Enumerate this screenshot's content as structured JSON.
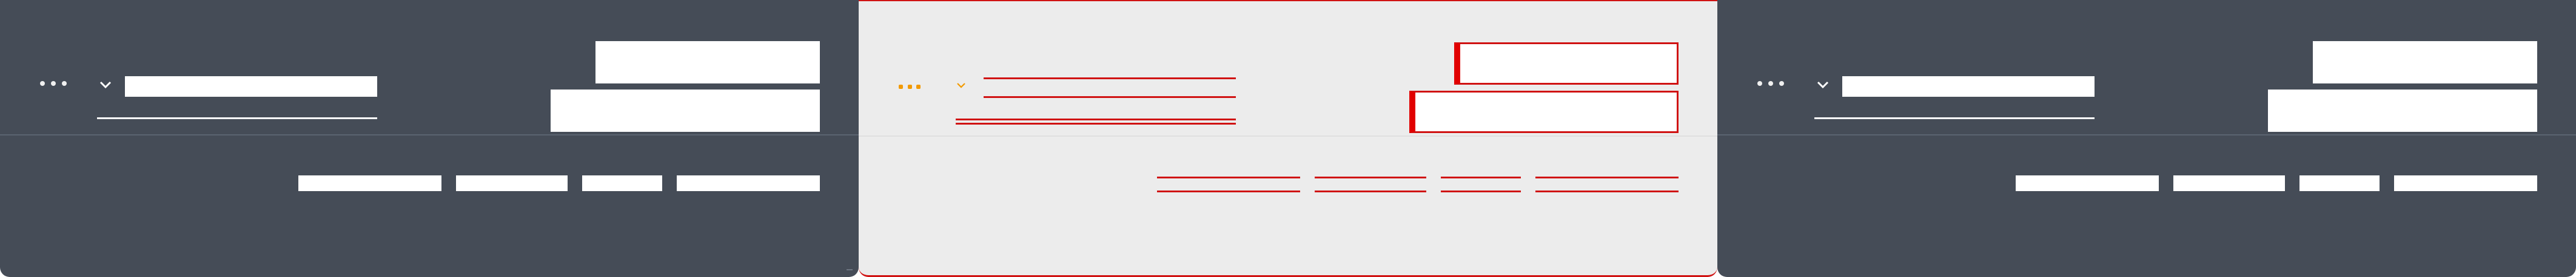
{
  "colors": {
    "panel_dark": "#454c57",
    "panel_light": "#ececec",
    "outline_red": "#d01212",
    "accent_orange": "#f29a00",
    "top_accent_navy": "#1f2a6b",
    "block_white": "#ffffff"
  },
  "panels": [
    {
      "id": "panel-left",
      "theme": "dark",
      "icons": {
        "more": "ellipsis-icon",
        "expand": "chevron-down-icon"
      },
      "field": {
        "value": "",
        "placeholder": ""
      },
      "buttons": [
        {
          "label": ""
        },
        {
          "label": ""
        }
      ],
      "links": [
        {
          "label": ""
        },
        {
          "label": ""
        },
        {
          "label": ""
        },
        {
          "label": ""
        }
      ]
    },
    {
      "id": "panel-center",
      "theme": "light-outlined",
      "icons": {
        "more": "ellipsis-icon",
        "expand": "chevron-down-icon"
      },
      "field": {
        "value": "",
        "placeholder": ""
      },
      "buttons": [
        {
          "label": ""
        },
        {
          "label": ""
        }
      ],
      "links": [
        {
          "label": ""
        },
        {
          "label": ""
        },
        {
          "label": ""
        },
        {
          "label": ""
        }
      ]
    },
    {
      "id": "panel-right",
      "theme": "dark",
      "icons": {
        "more": "ellipsis-icon",
        "expand": "chevron-down-icon"
      },
      "field": {
        "value": "",
        "placeholder": ""
      },
      "buttons": [
        {
          "label": ""
        },
        {
          "label": ""
        }
      ],
      "links": [
        {
          "label": ""
        },
        {
          "label": ""
        },
        {
          "label": ""
        },
        {
          "label": ""
        }
      ]
    }
  ]
}
